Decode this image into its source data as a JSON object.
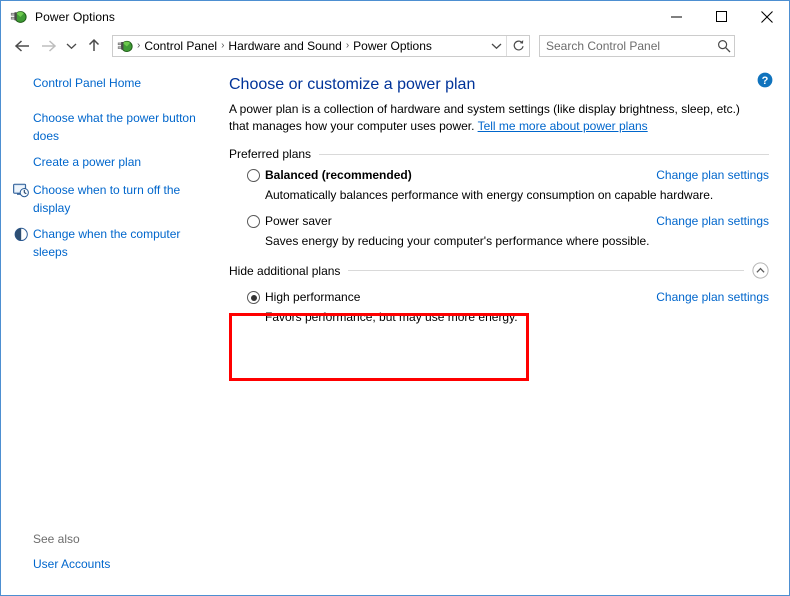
{
  "window": {
    "title": "Power Options",
    "icon": "power-plug-icon",
    "buttons": {
      "minimize": "Minimize",
      "maximize": "Maximize",
      "close": "Close"
    },
    "border_color": "#4d8fd1"
  },
  "navbar": {
    "back": "Back",
    "forward": "Forward",
    "recent": "Recent locations",
    "up": "Up one level",
    "breadcrumbs": [
      "Control Panel",
      "Hardware and Sound",
      "Power Options"
    ],
    "separator": "›",
    "dropdown": "Previous locations",
    "refresh": "Refresh",
    "search": {
      "placeholder": "Search Control Panel",
      "value": "",
      "icon": "search-icon"
    }
  },
  "sidebar": {
    "home_link": "Control Panel Home",
    "items": [
      {
        "label": "Choose what the power button does",
        "icon": null
      },
      {
        "label": "Create a power plan",
        "icon": null
      },
      {
        "label": "Choose when to turn off the display",
        "icon": "display-clock-icon"
      },
      {
        "label": "Change when the computer sleeps",
        "icon": "moon-sleep-icon"
      }
    ],
    "see_also_title": "See also",
    "see_also_items": [
      "User Accounts"
    ]
  },
  "main": {
    "help_button": "Help",
    "title": "Choose or customize a power plan",
    "intro_text": "A power plan is a collection of hardware and system settings (like display brightness, sleep, etc.) that manages how your computer uses power. ",
    "intro_link": "Tell me more about power plans",
    "preferred_group_label": "Preferred plans",
    "additional_group_label": "Hide additional plans",
    "collapse_icon": "chevron-up-circle-icon",
    "change_link_label": "Change plan settings",
    "preferred_plans": [
      {
        "name": "Balanced (recommended)",
        "description": "Automatically balances performance with energy consumption on capable hardware.",
        "selected": false,
        "bold": true
      },
      {
        "name": "Power saver",
        "description": "Saves energy by reducing your computer's performance where possible.",
        "selected": false,
        "bold": false
      }
    ],
    "additional_plans": [
      {
        "name": "High performance",
        "description": "Favors performance, but may use more energy.",
        "selected": true,
        "bold": false
      }
    ]
  },
  "annotation": {
    "type": "highlight-rectangle",
    "color": "#ff0000",
    "target": "High performance plan"
  }
}
